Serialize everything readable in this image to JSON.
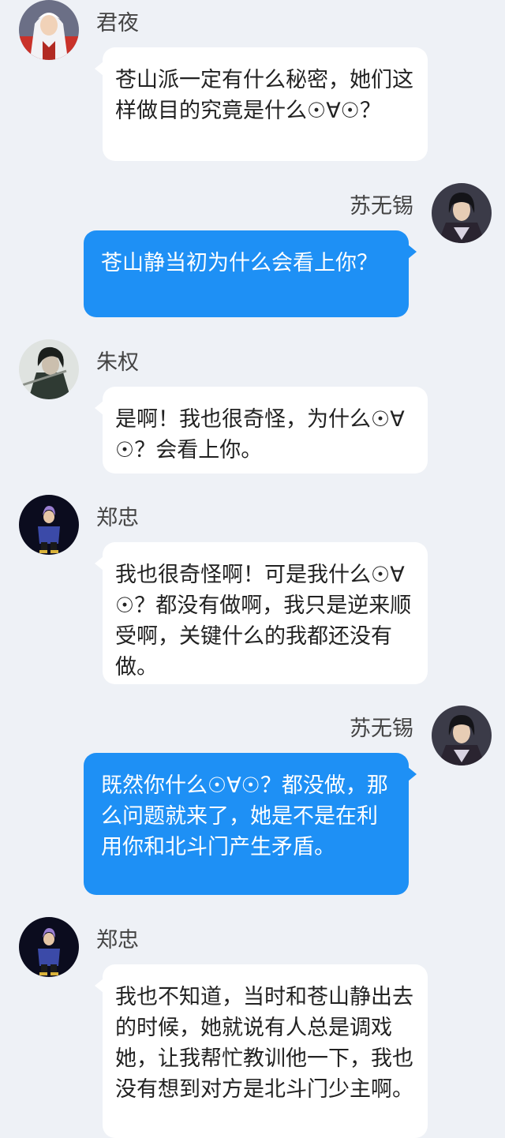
{
  "messages": [
    {
      "side": "left",
      "sender": "君夜",
      "avatar_icon": "white-haired-character-avatar",
      "text": "苍山派一定有什么秘密，她们这样做目的究竟是什么☉∀☉？"
    },
    {
      "side": "right",
      "sender": "苏无锡",
      "avatar_icon": "dark-haired-character-avatar",
      "text": "苍山静当初为什么会看上你？"
    },
    {
      "side": "left",
      "sender": "朱权",
      "avatar_icon": "swordsman-character-avatar",
      "text": "是啊！我也很奇怪，为什么☉∀☉？会看上你。"
    },
    {
      "side": "left",
      "sender": "郑忠",
      "avatar_icon": "purple-haired-character-avatar",
      "text": "我也很奇怪啊！可是我什么☉∀☉？都没有做啊，我只是逆来顺受啊，关键什么的我都还没有做。"
    },
    {
      "side": "right",
      "sender": "苏无锡",
      "avatar_icon": "dark-haired-character-avatar",
      "text": "既然你什么☉∀☉？都没做，那么问题就来了，她是不是在利用你和北斗门产生矛盾。"
    },
    {
      "side": "left",
      "sender": "郑忠",
      "avatar_icon": "purple-haired-character-avatar",
      "text": "我也不知道，当时和苍山静出去的时候，她就说有人总是调戏她，让我帮忙教训他一下，我也没有想到对方是北斗门少主啊。"
    }
  ],
  "colors": {
    "background": "#eef1f6",
    "incoming_bubble": "#ffffff",
    "outgoing_bubble": "#1e90f5",
    "outgoing_text": "#ffffff",
    "incoming_text": "#222222"
  }
}
